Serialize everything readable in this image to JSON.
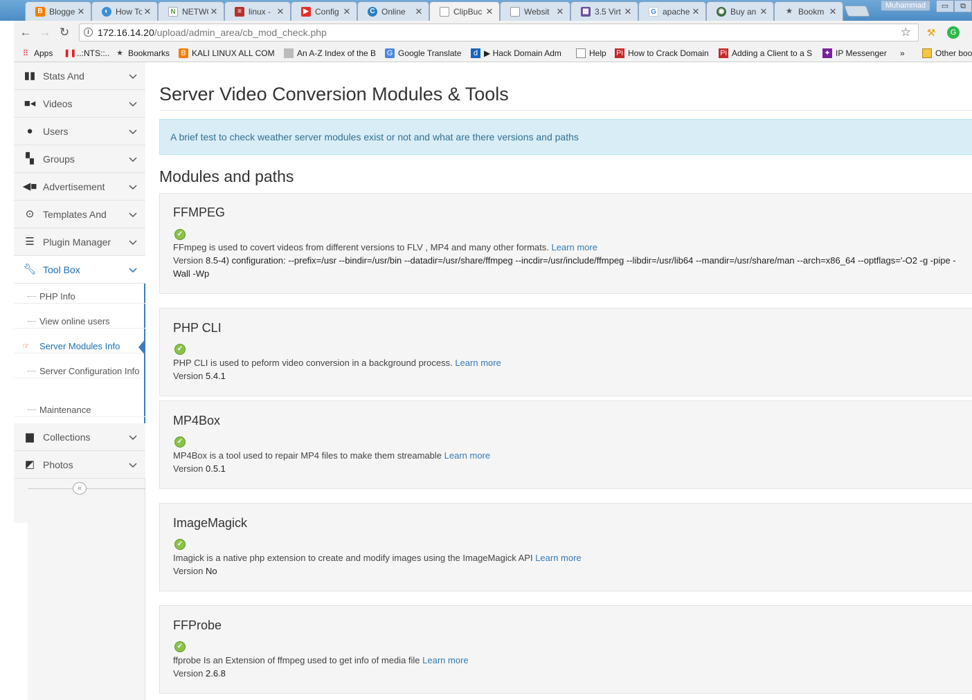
{
  "browser": {
    "tabs": [
      {
        "title": "Blogge",
        "favicon": "blogger-icon"
      },
      {
        "title": "How To",
        "favicon": "globe-icon"
      },
      {
        "title": "NETWO",
        "favicon": "n-icon"
      },
      {
        "title": "linux - ",
        "favicon": "stack-icon"
      },
      {
        "title": "Config",
        "favicon": "youtube-icon"
      },
      {
        "title": "Online",
        "favicon": "c-icon"
      },
      {
        "title": "ClipBuc",
        "favicon": "page-icon"
      },
      {
        "title": "Websit",
        "favicon": "page-icon"
      },
      {
        "title": "3.5 Virt",
        "favicon": "tiles-icon"
      },
      {
        "title": "apache",
        "favicon": "google-icon"
      },
      {
        "title": "Buy an",
        "favicon": "tag-icon"
      },
      {
        "title": "Bookm",
        "favicon": "star-icon"
      }
    ],
    "user_badge": "Muhammad",
    "address": {
      "host": "172.16.14.20",
      "path": "/upload/admin_area/cb_mod_check.php"
    },
    "bookmarks": [
      {
        "label": "Apps",
        "icon": "apps-grid-icon"
      },
      {
        "label": "..:NTS::..",
        "icon": "nts-icon"
      },
      {
        "label": "Bookmarks",
        "icon": "star-icon"
      },
      {
        "label": "KALI LINUX ALL COM",
        "icon": "blogger-icon"
      },
      {
        "label": "An A-Z Index of the B",
        "icon": "gray-square-icon"
      },
      {
        "label": "Google Translate",
        "icon": "translate-icon"
      },
      {
        "label": "▶ Hack Domain Adm",
        "icon": "d-icon"
      },
      {
        "label": "Help",
        "icon": "page-icon"
      },
      {
        "label": "How to Crack Domain",
        "icon": "pi-icon"
      },
      {
        "label": "Adding a Client to a S",
        "icon": "pi-icon"
      },
      {
        "label": "IP Messenger",
        "icon": "ipmsg-icon"
      },
      {
        "label": "»",
        "icon": "more-icon"
      },
      {
        "label": "Other boo",
        "icon": "folder-icon"
      }
    ]
  },
  "sidebar": {
    "items": [
      {
        "label": "Stats And",
        "icon": "bar-chart-icon"
      },
      {
        "label": "Videos",
        "icon": "video-camera-icon"
      },
      {
        "label": "Users",
        "icon": "user-icon"
      },
      {
        "label": "Groups",
        "icon": "grid-icon"
      },
      {
        "label": "Advertisement",
        "icon": "megaphone-icon"
      },
      {
        "label": "Templates And",
        "icon": "play-circle-icon"
      },
      {
        "label": "Plugin Manager",
        "icon": "server-icon"
      },
      {
        "label": "Tool Box",
        "icon": "wrench-icon"
      },
      {
        "label": "Collections",
        "icon": "trash-icon"
      },
      {
        "label": "Photos",
        "icon": "image-icon"
      }
    ],
    "toolbox_submenu": [
      "PHP Info",
      "View online users",
      "Server Modules Info",
      "Server Configuration Info",
      "Maintenance"
    ],
    "collapse_symbol": "«"
  },
  "main": {
    "title": "Server Video Conversion Modules & Tools",
    "info": "A brief test to check weather server modules exist or not and what are there versions and paths",
    "section_heading": "Modules and paths",
    "version_label": "Version",
    "learn_more": "Learn more",
    "modules": [
      {
        "name": "FFMPEG",
        "status": "ok",
        "description": "FFmpeg is used to covert videos from different versions to FLV , MP4 and many other formats.",
        "version": "8.5-4) configuration: --prefix=/usr --bindir=/usr/bin --datadir=/usr/share/ffmpeg --incdir=/usr/include/ffmpeg --libdir=/usr/lib64 --mandir=/usr/share/man --arch=x86_64 --optflags='-O2 -g -pipe -Wall -Wp"
      },
      {
        "name": "PHP CLI",
        "status": "ok",
        "description": "PHP CLI is used to peform video conversion in a background process.",
        "version": "5.4.1"
      },
      {
        "name": "MP4Box",
        "status": "ok",
        "description": "MP4Box is a tool used to repair MP4 files to make them streamable",
        "version": "0.5.1"
      },
      {
        "name": "ImageMagick",
        "status": "ok",
        "description": "Imagick is a native php extension to create and modify images using the ImageMagick API",
        "version": "No"
      },
      {
        "name": "FFProbe",
        "status": "ok",
        "description": "ffprobe Is an Extension of ffmpeg used to get info of media file",
        "version": "2.6.8"
      }
    ]
  }
}
